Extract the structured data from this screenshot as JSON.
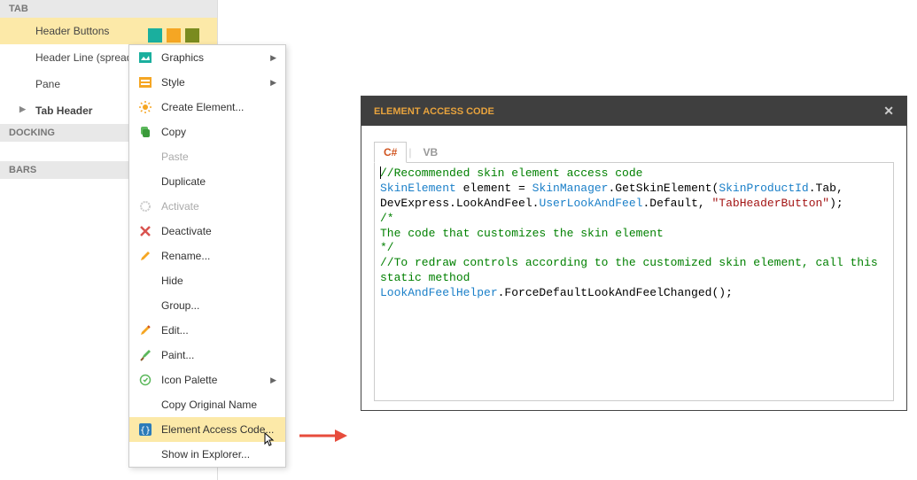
{
  "tree": {
    "sections": [
      {
        "id": "tab",
        "label": "TAB",
        "items": [
          {
            "id": "header-buttons",
            "label": "Header Buttons",
            "selected": true
          },
          {
            "id": "header-line",
            "label": "Header Line (spread"
          },
          {
            "id": "pane",
            "label": "Pane"
          },
          {
            "id": "tab-header",
            "label": "Tab Header",
            "bold": true,
            "expandable": true
          }
        ]
      },
      {
        "id": "docking",
        "label": "DOCKING",
        "items": []
      },
      {
        "id": "bars",
        "label": "BARS",
        "items": []
      }
    ],
    "swatches": [
      "teal",
      "orange",
      "olive"
    ]
  },
  "contextMenu": [
    {
      "id": "graphics",
      "label": "Graphics",
      "icon": "image",
      "submenu": true
    },
    {
      "id": "style",
      "label": "Style",
      "icon": "style",
      "submenu": true
    },
    {
      "id": "create-element",
      "label": "Create Element...",
      "icon": "sun"
    },
    {
      "id": "copy",
      "label": "Copy",
      "icon": "copy"
    },
    {
      "id": "paste",
      "label": "Paste",
      "disabled": true
    },
    {
      "id": "duplicate",
      "label": "Duplicate"
    },
    {
      "id": "activate",
      "label": "Activate",
      "icon": "gear",
      "disabled": true
    },
    {
      "id": "deactivate",
      "label": "Deactivate",
      "icon": "x"
    },
    {
      "id": "rename",
      "label": "Rename...",
      "icon": "pencil"
    },
    {
      "id": "hide",
      "label": "Hide"
    },
    {
      "id": "group",
      "label": "Group..."
    },
    {
      "id": "edit",
      "label": "Edit...",
      "icon": "pencil2"
    },
    {
      "id": "paint",
      "label": "Paint...",
      "icon": "brush"
    },
    {
      "id": "icon-palette",
      "label": "Icon Palette",
      "icon": "target",
      "submenu": true
    },
    {
      "id": "copy-original",
      "label": "Copy Original Name"
    },
    {
      "id": "element-access",
      "label": "Element Access Code...",
      "icon": "braces",
      "highlighted": true
    },
    {
      "id": "show-explorer",
      "label": "Show in Explorer..."
    }
  ],
  "dialog": {
    "title": "ELEMENT ACCESS CODE",
    "tabs": {
      "active": "C#",
      "other": "VB"
    },
    "code": {
      "line1": "//Recommended skin element access code",
      "l2a": "SkinElement",
      "l2b": " element = ",
      "l2c": "SkinManager",
      "l2d": ".GetSkinElement(",
      "l2e": "SkinProductId",
      "l2f": ".Tab, DevExpress.LookAndFeel.",
      "l2g": "UserLookAndFeel",
      "l2h": ".Default, ",
      "l2i": "\"TabHeaderButton\"",
      "l2j": ");",
      "l3": "/*",
      "l4": "The code that customizes the skin element",
      "l5": "*/",
      "l6": "//To redraw controls according to the customized skin element, call this static method",
      "l7a": "LookAndFeelHelper",
      "l7b": ".ForceDefaultLookAndFeelChanged();"
    }
  }
}
